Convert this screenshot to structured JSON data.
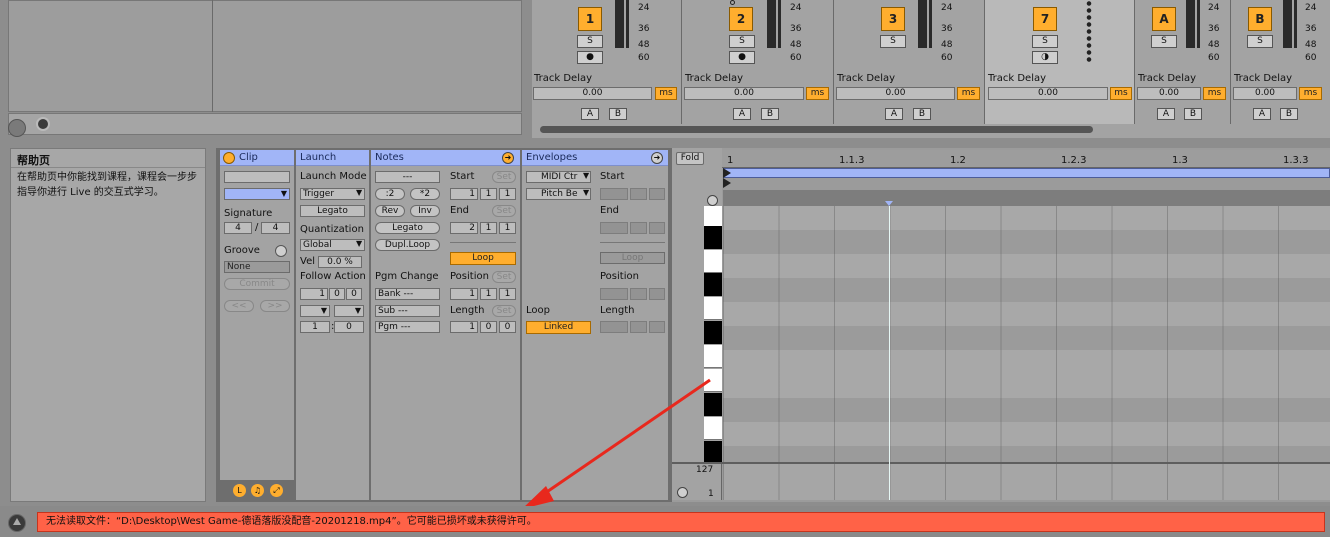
{
  "tracks": [
    {
      "num": "1",
      "solo": "S",
      "arm": "●",
      "ticks": [
        "24",
        "36",
        "48",
        "60"
      ],
      "delay_label": "Track Delay",
      "delay_value": "0.00",
      "unit": "ms",
      "a": "A",
      "b": "B"
    },
    {
      "num": "2",
      "solo": "S",
      "arm": "●",
      "ticks": [
        "24",
        "36",
        "48",
        "60"
      ],
      "delay_label": "Track Delay",
      "delay_value": "0.00",
      "unit": "ms",
      "a": "A",
      "b": "B"
    },
    {
      "num": "3",
      "solo": "S",
      "arm": "",
      "ticks": [
        "24",
        "36",
        "48",
        "60"
      ],
      "delay_label": "Track Delay",
      "delay_value": "0.00",
      "unit": "ms",
      "a": "A",
      "b": "B"
    },
    {
      "num": "7",
      "solo": "S",
      "arm": "◑",
      "ticks": [],
      "delay_label": "Track Delay",
      "delay_value": "0.00",
      "unit": "ms",
      "a": "",
      "b": ""
    },
    {
      "num": "A",
      "solo": "S",
      "arm": "",
      "ticks": [
        "24",
        "36",
        "48",
        "60"
      ],
      "delay_label": "Track Delay",
      "delay_value": "0.00",
      "unit": "ms",
      "a": "A",
      "b": "B"
    },
    {
      "num": "B",
      "solo": "S",
      "arm": "",
      "ticks": [
        "24",
        "36",
        "48",
        "60"
      ],
      "delay_label": "Track Delay",
      "delay_value": "0.00",
      "unit": "ms",
      "a": "A",
      "b": "B"
    }
  ],
  "help": {
    "title": "帮助页",
    "text": "在帮助页中你能找到课程，课程会一步步指导你进行 Live 的交互式学习。"
  },
  "clip": {
    "header": "Clip",
    "name_value": "",
    "signature_label": "Signature",
    "sig_num": "4",
    "sig_slash": "/",
    "sig_den": "4",
    "groove_label": "Groove",
    "groove_value": "None",
    "commit": "Commit",
    "prev": "<<",
    "next": ">>",
    "footer_icons": [
      "L",
      "♫",
      "⤢"
    ]
  },
  "launch": {
    "header": "Launch",
    "mode_label": "Launch Mode",
    "mode_value": "Trigger",
    "legato": "Legato",
    "quant_label": "Quantization",
    "quant_value": "Global",
    "vel_label": "Vel",
    "vel_value": "0.0 %",
    "follow_label": "Follow Action",
    "follow_time": [
      "1",
      "0",
      "0"
    ],
    "follow_chance": [
      "1",
      ":",
      "0"
    ]
  },
  "notes": {
    "header": "Notes",
    "range": "---",
    "div2": ":2",
    "mul2": "*2",
    "rev": "Rev",
    "inv": "Inv",
    "legato": "Legato",
    "dupl": "Dupl.Loop",
    "start_label": "Start",
    "set": "Set",
    "start": [
      "1",
      "1",
      "1"
    ],
    "end_label": "End",
    "end": [
      "2",
      "1",
      "1"
    ],
    "loop": "Loop",
    "position_label": "Position",
    "position": [
      "1",
      "1",
      "1"
    ],
    "length_label": "Length",
    "length": [
      "1",
      "0",
      "0"
    ],
    "pgm_label": "Pgm Change",
    "bank": "Bank ---",
    "sub": "Sub ---",
    "pgm": "Pgm ---"
  },
  "envelopes": {
    "header": "Envelopes",
    "dev": "MIDI Ctr",
    "ctrl": "Pitch Be",
    "loop_label": "Loop",
    "linked": "Linked",
    "start_label": "Start",
    "end_label": "End",
    "loop": "Loop",
    "position_label": "Position",
    "length_label": "Length"
  },
  "editor": {
    "fold": "Fold",
    "ruler": [
      "1",
      "1.1.3",
      "1.2",
      "1.2.3",
      "1.3",
      "1.3.3"
    ],
    "vel_max": "127",
    "vel_min": "1"
  },
  "status": {
    "message": "无法读取文件：“D:\\Desktop\\West Game-德语落版没配音-20201218.mp4”。它可能已损坏或未获得许可。"
  },
  "colors": {
    "accent": "#ffae2e",
    "header": "#a1b5f7",
    "status_bg": "#ff6247",
    "arrow": "#e8281d"
  }
}
